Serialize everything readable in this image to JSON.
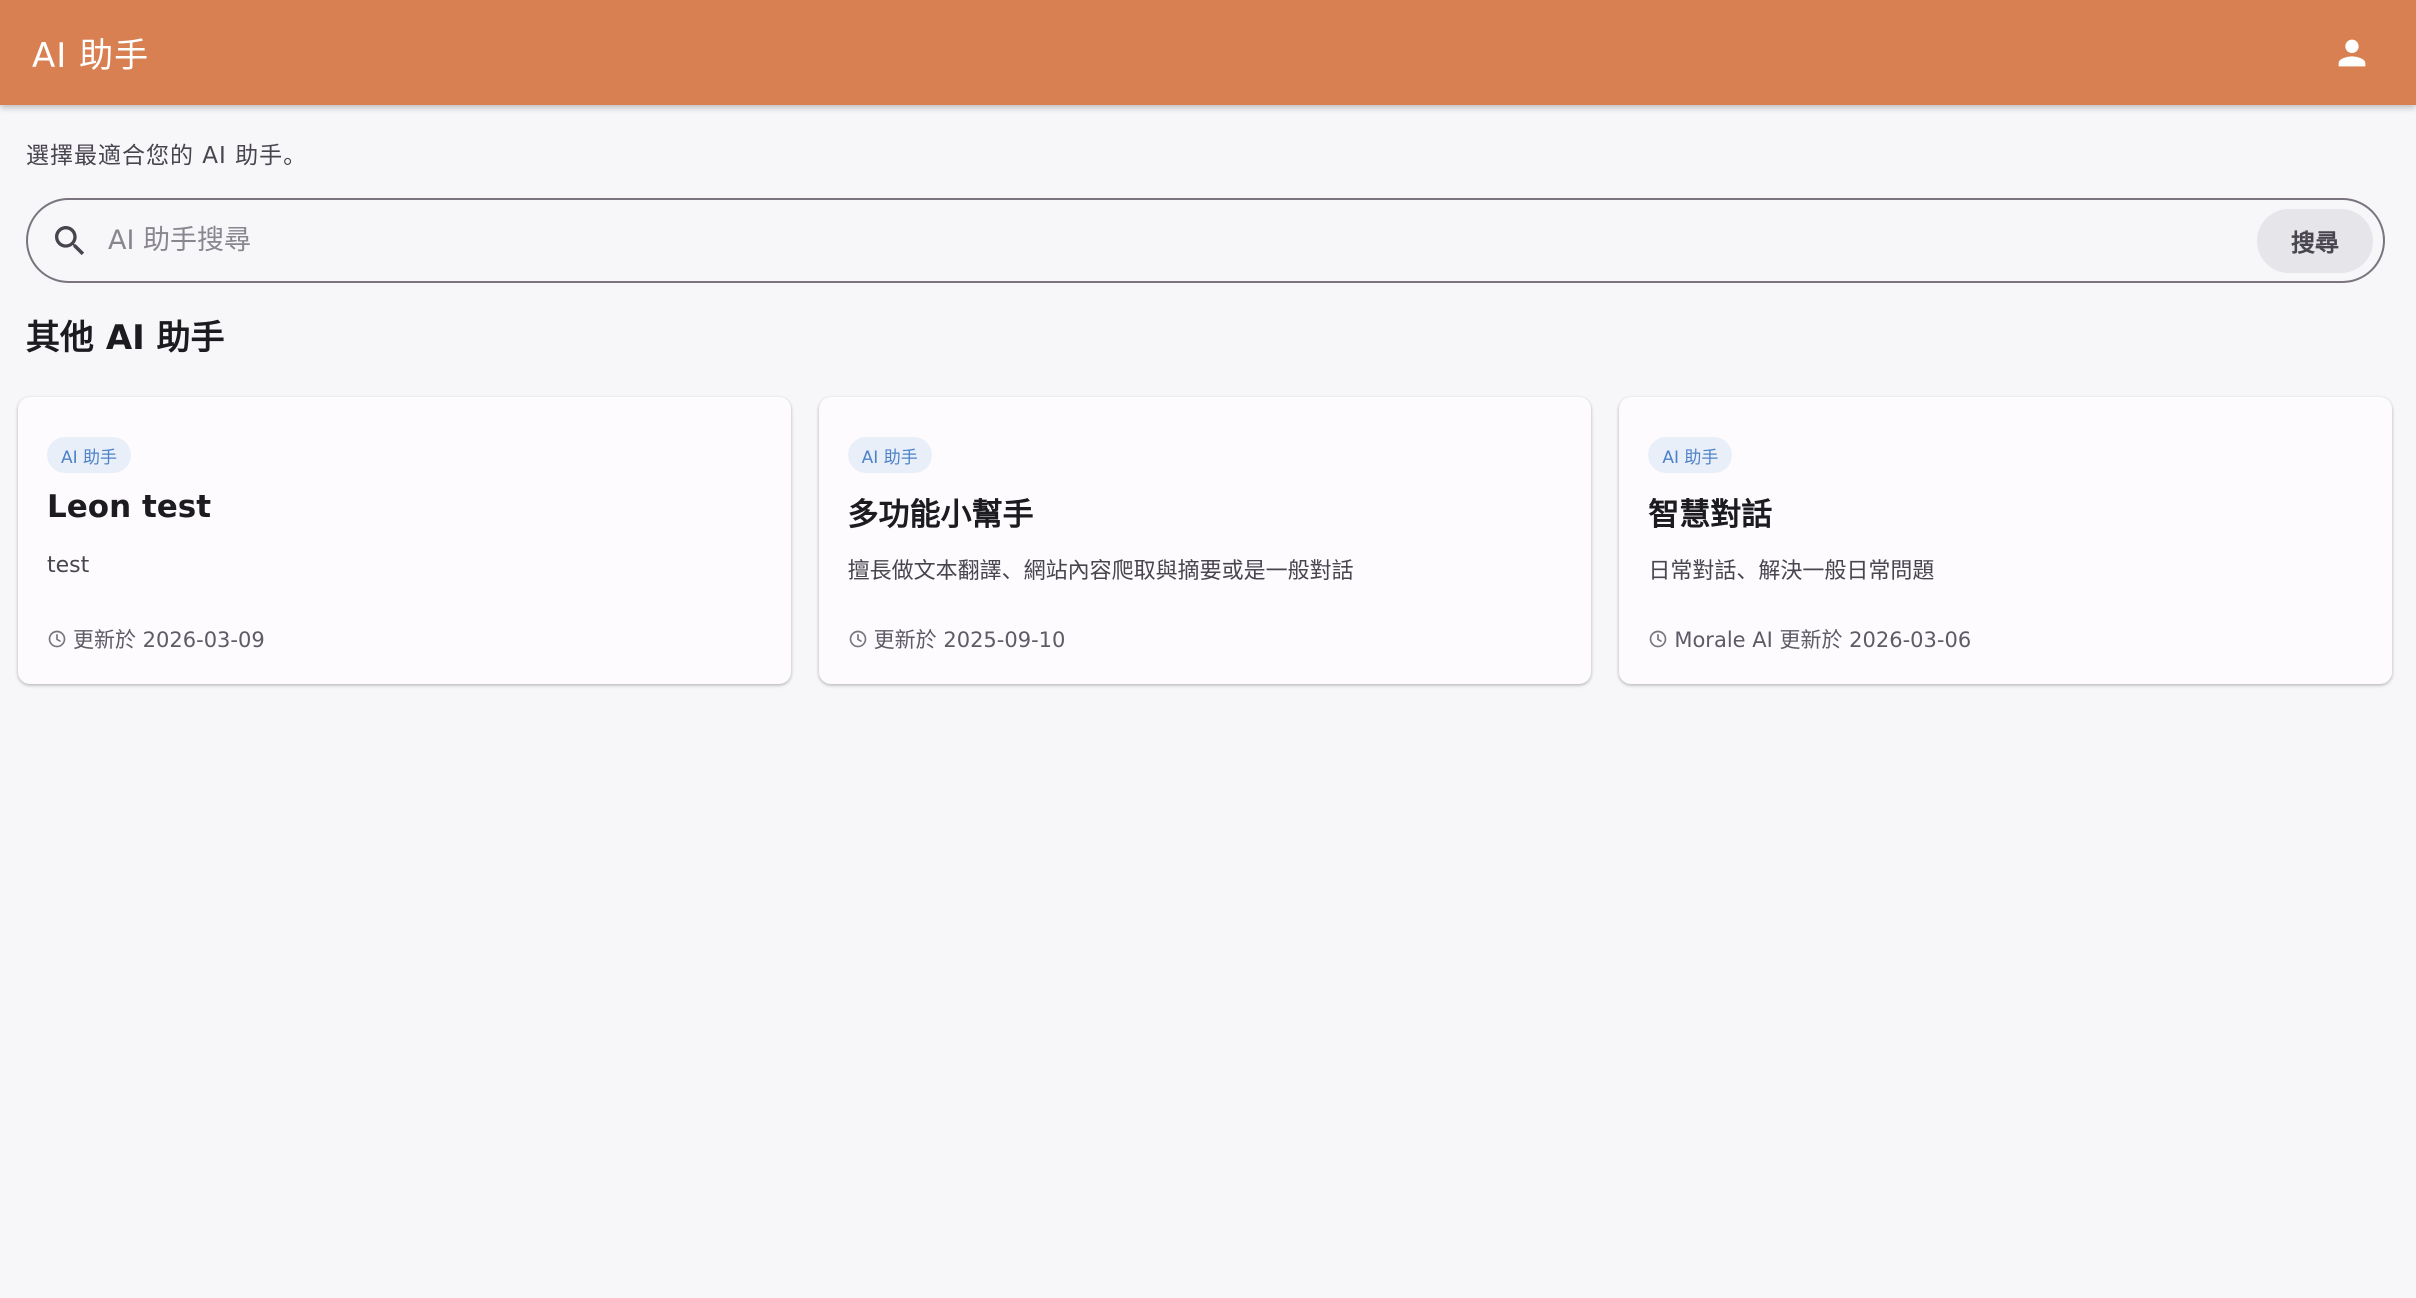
{
  "appbar": {
    "title": "AI 助手",
    "account_icon": "account-icon",
    "background": "#d98053"
  },
  "subtitle": "選擇最適合您的 AI 助手。",
  "search": {
    "placeholder": "AI 助手搜尋",
    "value": "",
    "button_label": "搜尋",
    "icon": "search-icon"
  },
  "section_title": "其他 AI 助手",
  "cards": [
    {
      "chip": "AI 助手",
      "title": "Leon test",
      "description": "test",
      "meta": "更新於 2026-03-09",
      "meta_icon": "clock-icon"
    },
    {
      "chip": "AI 助手",
      "title": "多功能小幫手",
      "description": "擅長做文本翻譯、網站內容爬取與摘要或是一般對話",
      "meta": "更新於 2025-09-10",
      "meta_icon": "clock-icon"
    },
    {
      "chip": "AI 助手",
      "title": "智慧對話",
      "description": "日常對話、解決一般日常問題",
      "meta": "Morale AI 更新於 2026-03-06",
      "meta_icon": "clock-icon"
    }
  ]
}
